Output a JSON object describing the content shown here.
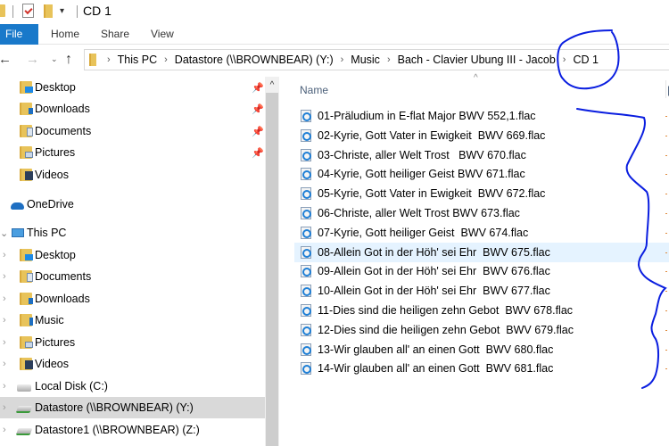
{
  "window": {
    "title": "CD 1",
    "quick_access_dropdown": "▾"
  },
  "ribbon": {
    "tabs": [
      {
        "label": "File"
      },
      {
        "label": "Home"
      },
      {
        "label": "Share"
      },
      {
        "label": "View"
      }
    ]
  },
  "navigation": {
    "back": "←",
    "forward": "→",
    "recent": "⌄",
    "up": "↑",
    "separator": "›",
    "breadcrumbs": [
      "This PC",
      "Datastore (\\\\BROWNBEAR) (Y:)",
      "Music",
      "Bach - Clavier Ubung III - Jacob",
      "CD 1"
    ]
  },
  "sidebar": {
    "quick_access": [
      {
        "label": "Desktop",
        "icon": "desktop-folder-icon",
        "pinned": true
      },
      {
        "label": "Downloads",
        "icon": "downloads-folder-icon",
        "pinned": true
      },
      {
        "label": "Documents",
        "icon": "documents-folder-icon",
        "pinned": true
      },
      {
        "label": "Pictures",
        "icon": "pictures-folder-icon",
        "pinned": true
      },
      {
        "label": "Videos",
        "icon": "videos-folder-icon",
        "pinned": false
      }
    ],
    "onedrive": {
      "label": "OneDrive",
      "icon": "onedrive-cloud-icon"
    },
    "this_pc": {
      "label": "This PC",
      "icon": "computer-icon",
      "children": [
        {
          "label": "Desktop",
          "icon": "desktop-folder-icon"
        },
        {
          "label": "Documents",
          "icon": "documents-folder-icon"
        },
        {
          "label": "Downloads",
          "icon": "downloads-folder-icon"
        },
        {
          "label": "Music",
          "icon": "music-folder-icon"
        },
        {
          "label": "Pictures",
          "icon": "pictures-folder-icon"
        },
        {
          "label": "Videos",
          "icon": "videos-folder-icon"
        },
        {
          "label": "Local Disk (C:)",
          "icon": "local-disk-icon"
        },
        {
          "label": "Datastore (\\\\BROWNBEAR) (Y:)",
          "icon": "network-drive-icon",
          "selected": true
        },
        {
          "label": "Datastore1 (\\\\BROWNBEAR) (Z:)",
          "icon": "network-drive-icon"
        }
      ]
    },
    "pin_glyph": "📌",
    "expander_glyph": "›"
  },
  "content": {
    "column_header": "Name",
    "sort_indicator": "^",
    "hovered_index": 7,
    "files": [
      "01-Präludium in E-flat Major BWV 552,1.flac",
      "02-Kyrie, Gott Vater in Ewigkeit  BWV 669.flac",
      "03-Christe, aller Welt Trost   BWV 670.flac",
      "04-Kyrie, Gott heiliger Geist BWV 671.flac",
      "05-Kyrie, Gott Vater in Ewigkeit  BWV 672.flac",
      "06-Christe, aller Welt Trost BWV 673.flac",
      "07-Kyrie, Gott heiliger Geist  BWV 674.flac",
      "08-Allein Got in der Höh' sei Ehr  BWV 675.flac",
      "09-Allein Got in der Höh' sei Ehr  BWV 676.flac",
      "10-Allein Got in der Höh' sei Ehr  BWV 677.flac",
      "11-Dies sind die heiligen zehn Gebot  BWV 678.flac",
      "12-Dies sind die heiligen zehn Gebot  BWV 679.flac",
      "13-Wir glauben all' an einen Gott  BWV 680.flac",
      "14-Wir glauben all' an einen Gott  BWV 681.flac"
    ]
  },
  "annotation": {
    "color": "#0a1ee0",
    "description": "hand-drawn circle around CD 1 and wavy line beside file list"
  }
}
